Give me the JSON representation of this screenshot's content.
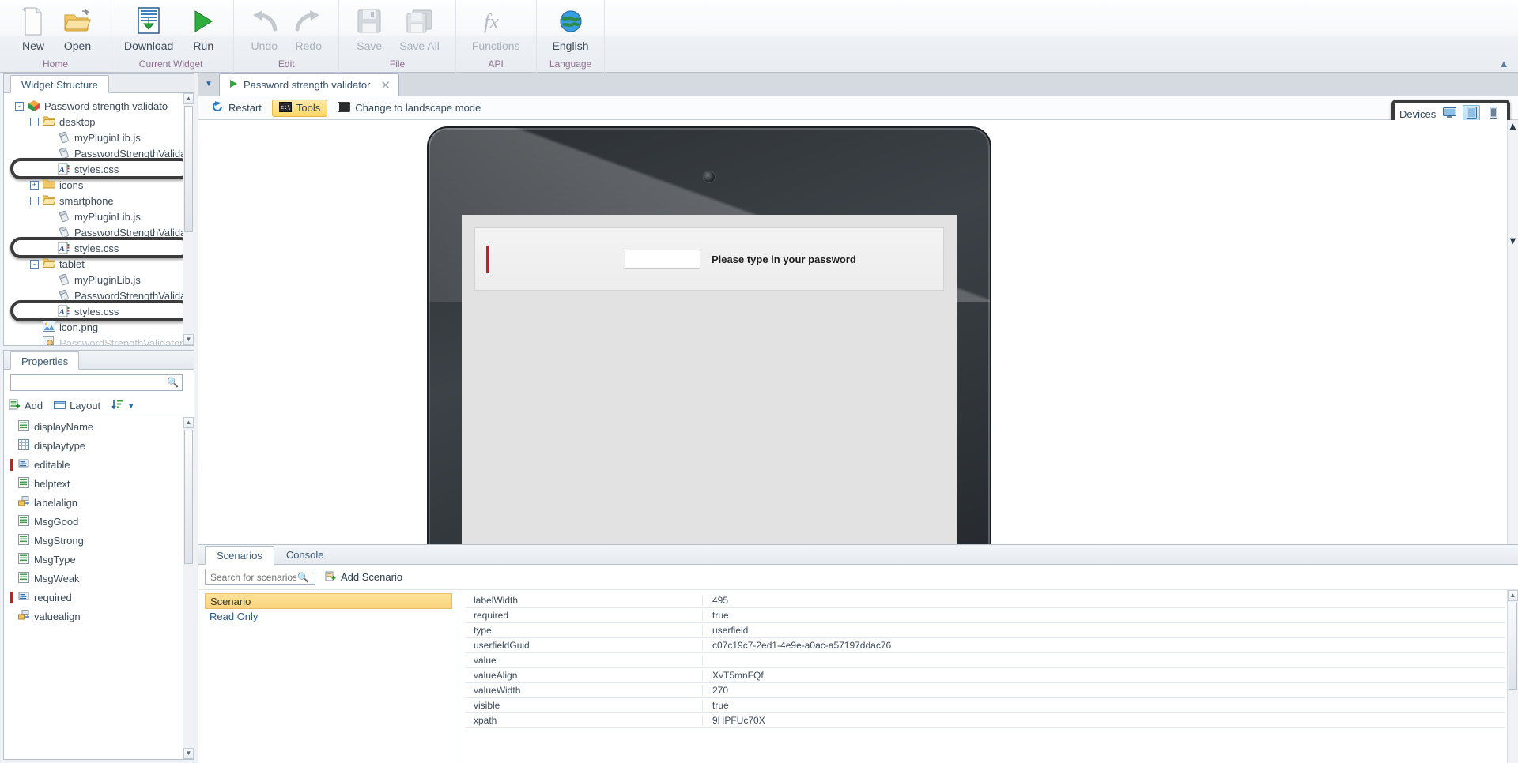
{
  "ribbon": {
    "groups": [
      {
        "title": "Home",
        "buttons": [
          {
            "label": "New",
            "icon": "new-document-icon",
            "disabled": false
          },
          {
            "label": "Open",
            "icon": "open-folder-icon",
            "disabled": false
          }
        ]
      },
      {
        "title": "Current Widget",
        "buttons": [
          {
            "label": "Download",
            "icon": "download-icon",
            "disabled": false
          },
          {
            "label": "Run",
            "icon": "run-play-icon",
            "disabled": false
          }
        ]
      },
      {
        "title": "Edit",
        "buttons": [
          {
            "label": "Undo",
            "icon": "undo-arrow-icon",
            "disabled": true
          },
          {
            "label": "Redo",
            "icon": "redo-arrow-icon",
            "disabled": true
          }
        ]
      },
      {
        "title": "File",
        "buttons": [
          {
            "label": "Save",
            "icon": "floppy-save-icon",
            "disabled": true
          },
          {
            "label": "Save All",
            "icon": "save-all-icon",
            "disabled": true
          }
        ]
      },
      {
        "title": "API",
        "buttons": [
          {
            "label": "Functions",
            "icon": "fx-functions-icon",
            "disabled": true
          }
        ]
      },
      {
        "title": "Language",
        "buttons": [
          {
            "label": "English",
            "icon": "globe-language-icon",
            "disabled": false
          }
        ]
      }
    ],
    "collapse_icon": "collapse-ribbon-icon"
  },
  "left": {
    "tree_panel": {
      "tab_label": "Widget Structure"
    },
    "tree": [
      {
        "label": "Password strength validato",
        "depth": 0,
        "expander": "-",
        "icon": "widget-package-icon",
        "highlight": false,
        "faded": false
      },
      {
        "label": "desktop",
        "depth": 1,
        "expander": "-",
        "icon": "folder-open-icon",
        "highlight": false,
        "faded": false
      },
      {
        "label": "myPluginLib.js",
        "depth": 2,
        "expander": "",
        "icon": "js-file-icon",
        "highlight": false,
        "faded": false
      },
      {
        "label": "PasswordStrengthValidator.",
        "depth": 2,
        "expander": "",
        "icon": "js-file-icon",
        "highlight": false,
        "faded": false
      },
      {
        "label": "styles.css",
        "depth": 2,
        "expander": "",
        "icon": "css-file-icon",
        "highlight": true,
        "faded": false
      },
      {
        "label": "icons",
        "depth": 1,
        "expander": "+",
        "icon": "folder-closed-icon",
        "highlight": false,
        "faded": false
      },
      {
        "label": "smartphone",
        "depth": 1,
        "expander": "-",
        "icon": "folder-open-icon",
        "highlight": false,
        "faded": false
      },
      {
        "label": "myPluginLib.js",
        "depth": 2,
        "expander": "",
        "icon": "js-file-icon",
        "highlight": false,
        "faded": false
      },
      {
        "label": "PasswordStrengthValidator.",
        "depth": 2,
        "expander": "",
        "icon": "js-file-icon",
        "highlight": false,
        "faded": false
      },
      {
        "label": "styles.css",
        "depth": 2,
        "expander": "",
        "icon": "css-file-icon",
        "highlight": true,
        "faded": false
      },
      {
        "label": "tablet",
        "depth": 1,
        "expander": "-",
        "icon": "folder-open-icon",
        "highlight": false,
        "faded": false
      },
      {
        "label": "myPluginLib.js",
        "depth": 2,
        "expander": "",
        "icon": "js-file-icon",
        "highlight": false,
        "faded": false
      },
      {
        "label": "PasswordStrengthValidator.",
        "depth": 2,
        "expander": "",
        "icon": "js-file-icon",
        "highlight": false,
        "faded": false
      },
      {
        "label": "styles.css",
        "depth": 2,
        "expander": "",
        "icon": "css-file-icon",
        "highlight": true,
        "faded": false
      },
      {
        "label": "icon.png",
        "depth": 1,
        "expander": "",
        "icon": "image-file-icon",
        "highlight": false,
        "faded": false
      },
      {
        "label": "PasswordStrengthValidator.",
        "depth": 1,
        "expander": "",
        "icon": "xml-file-icon",
        "highlight": false,
        "faded": true
      }
    ],
    "properties_panel": {
      "tab_label": "Properties",
      "search_placeholder": "",
      "toolbar": [
        {
          "label": "Add",
          "icon": "add-property-icon"
        },
        {
          "label": "Layout",
          "icon": "layout-folder-icon"
        },
        {
          "label": "",
          "icon": "sort-az-icon"
        }
      ],
      "items": [
        {
          "label": "displayName",
          "icon": "text-property-icon",
          "required": false
        },
        {
          "label": "displaytype",
          "icon": "grid-property-icon",
          "required": false
        },
        {
          "label": "editable",
          "icon": "editable-property-icon",
          "required": true
        },
        {
          "label": "helptext",
          "icon": "text-property-icon",
          "required": false
        },
        {
          "label": "labelalign",
          "icon": "align-property-icon",
          "required": false
        },
        {
          "label": "MsgGood",
          "icon": "text-property-icon",
          "required": false
        },
        {
          "label": "MsgStrong",
          "icon": "text-property-icon",
          "required": false
        },
        {
          "label": "MsgType",
          "icon": "text-property-icon",
          "required": false
        },
        {
          "label": "MsgWeak",
          "icon": "text-property-icon",
          "required": false
        },
        {
          "label": "required",
          "icon": "editable-property-icon",
          "required": true
        },
        {
          "label": "valuealign",
          "icon": "align-property-icon",
          "required": false
        }
      ]
    }
  },
  "main": {
    "document_tab": {
      "label": "Password strength validator",
      "icon": "run-play-icon",
      "close_icon": "close-icon",
      "chevron_icon": "chevron-down-icon"
    },
    "preview_toolbar": [
      {
        "label": "Restart",
        "icon": "restart-icon",
        "active": false
      },
      {
        "label": "Tools",
        "icon": "tools-console-icon",
        "active": true
      },
      {
        "label": "Change to landscape mode",
        "icon": "landscape-icon",
        "active": false
      }
    ],
    "devices": {
      "label": "Devices",
      "buttons": [
        {
          "icon": "desktop-device-icon",
          "selected": false
        },
        {
          "icon": "tablet-device-icon",
          "selected": true
        },
        {
          "icon": "smartphone-device-icon",
          "selected": false
        }
      ]
    },
    "device_preview": {
      "password_placeholder": "",
      "caption": "Please type in your password"
    }
  },
  "bottom": {
    "tabs": [
      {
        "label": "Scenarios",
        "active": true
      },
      {
        "label": "Console",
        "active": false
      }
    ],
    "search_placeholder": "Search for scenarios",
    "search_value": "",
    "add_scenario_label": "Add Scenario",
    "add_scenario_icon": "add-scenario-icon",
    "scenarios": [
      {
        "label": "Scenario",
        "selected": true
      },
      {
        "label": "Read Only",
        "selected": false
      }
    ],
    "property_rows": [
      {
        "key": "labelWidth",
        "value": "495"
      },
      {
        "key": "required",
        "value": "true"
      },
      {
        "key": "type",
        "value": "userfield"
      },
      {
        "key": "userfieldGuid",
        "value": "c07c19c7-2ed1-4e9e-a0ac-a57197ddac76"
      },
      {
        "key": "value",
        "value": ""
      },
      {
        "key": "valueAlign",
        "value": "XvT5mnFQf"
      },
      {
        "key": "valueWidth",
        "value": "270"
      },
      {
        "key": "visible",
        "value": "true"
      },
      {
        "key": "xpath",
        "value": "9HPFUc70X"
      }
    ]
  },
  "colors": {
    "accent_yellow": "#f9d47c",
    "link_blue": "#2f5c8a",
    "required_red": "#d01a1a",
    "callout_black": "#3b3b3b"
  }
}
